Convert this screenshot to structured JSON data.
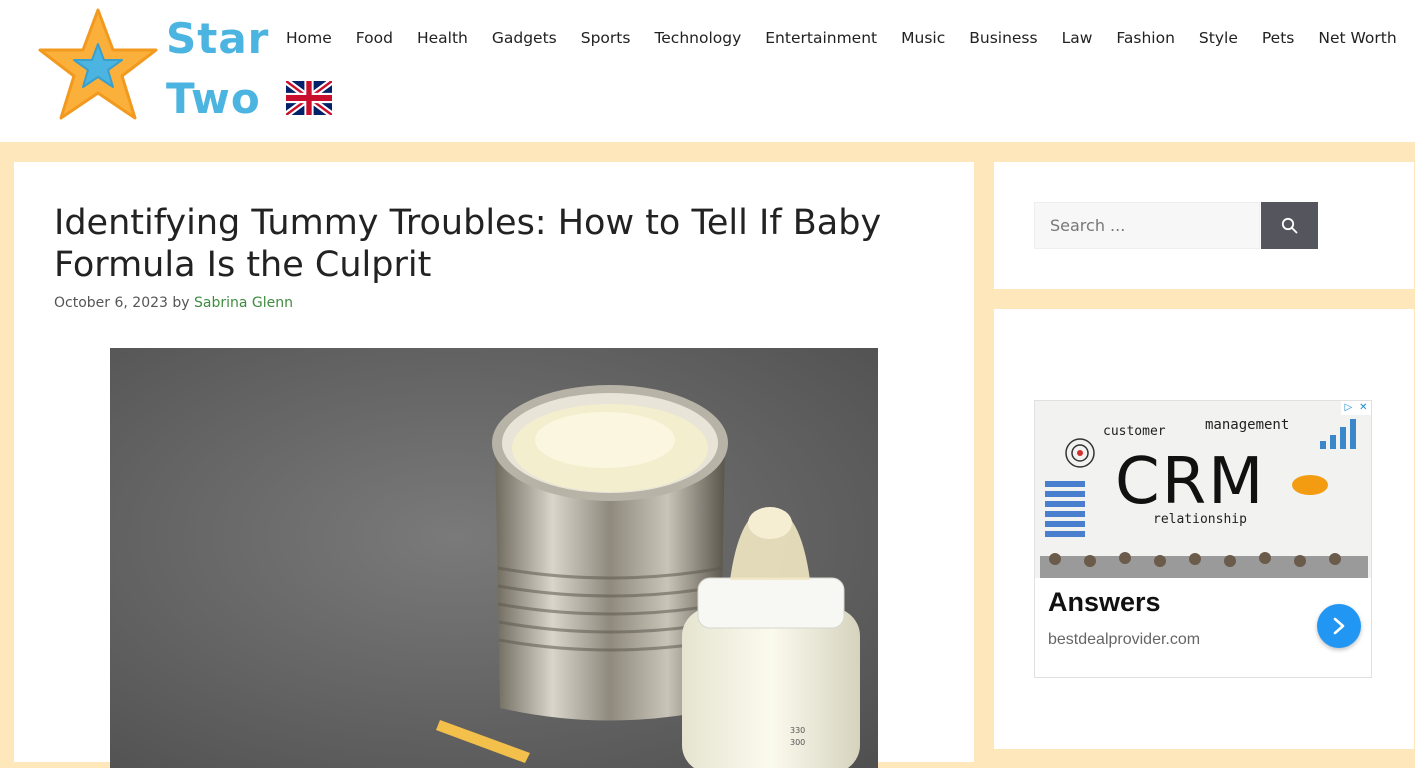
{
  "site": {
    "logo_line1": "Star",
    "logo_line2": "Two",
    "language_flag_icon": "uk-flag-icon",
    "colors": {
      "logo_text": "#4cb4e0",
      "star": "#fbb03b",
      "inner_star": "#4cb4e0",
      "background": "#ffe7bc",
      "author_link": "#3f8b3f"
    }
  },
  "nav": {
    "items": [
      "Home",
      "Food",
      "Health",
      "Gadgets",
      "Sports",
      "Technology",
      "Entertainment",
      "Music",
      "Business",
      "Law",
      "Fashion",
      "Style",
      "Pets",
      "Net Worth"
    ]
  },
  "article": {
    "title": "Identifying Tummy Troubles: How to Tell If Baby Formula Is the Culprit",
    "date": "October 6, 2023",
    "by": "by",
    "author": "Sabrina Glenn",
    "image_icon": "baby-formula-can-and-bottle-image"
  },
  "sidebar": {
    "search_placeholder": "Search ...",
    "search_icon": "search-icon",
    "ad": {
      "image_words": [
        "customer",
        "management",
        "CRM",
        "relationship"
      ],
      "headline": "Answers",
      "domain": "bestdealprovider.com",
      "arrow_icon": "chevron-right-icon",
      "adchoices_icon": "adchoices-icon",
      "close_icon": "close-icon",
      "button_color": "#2196f3"
    }
  }
}
